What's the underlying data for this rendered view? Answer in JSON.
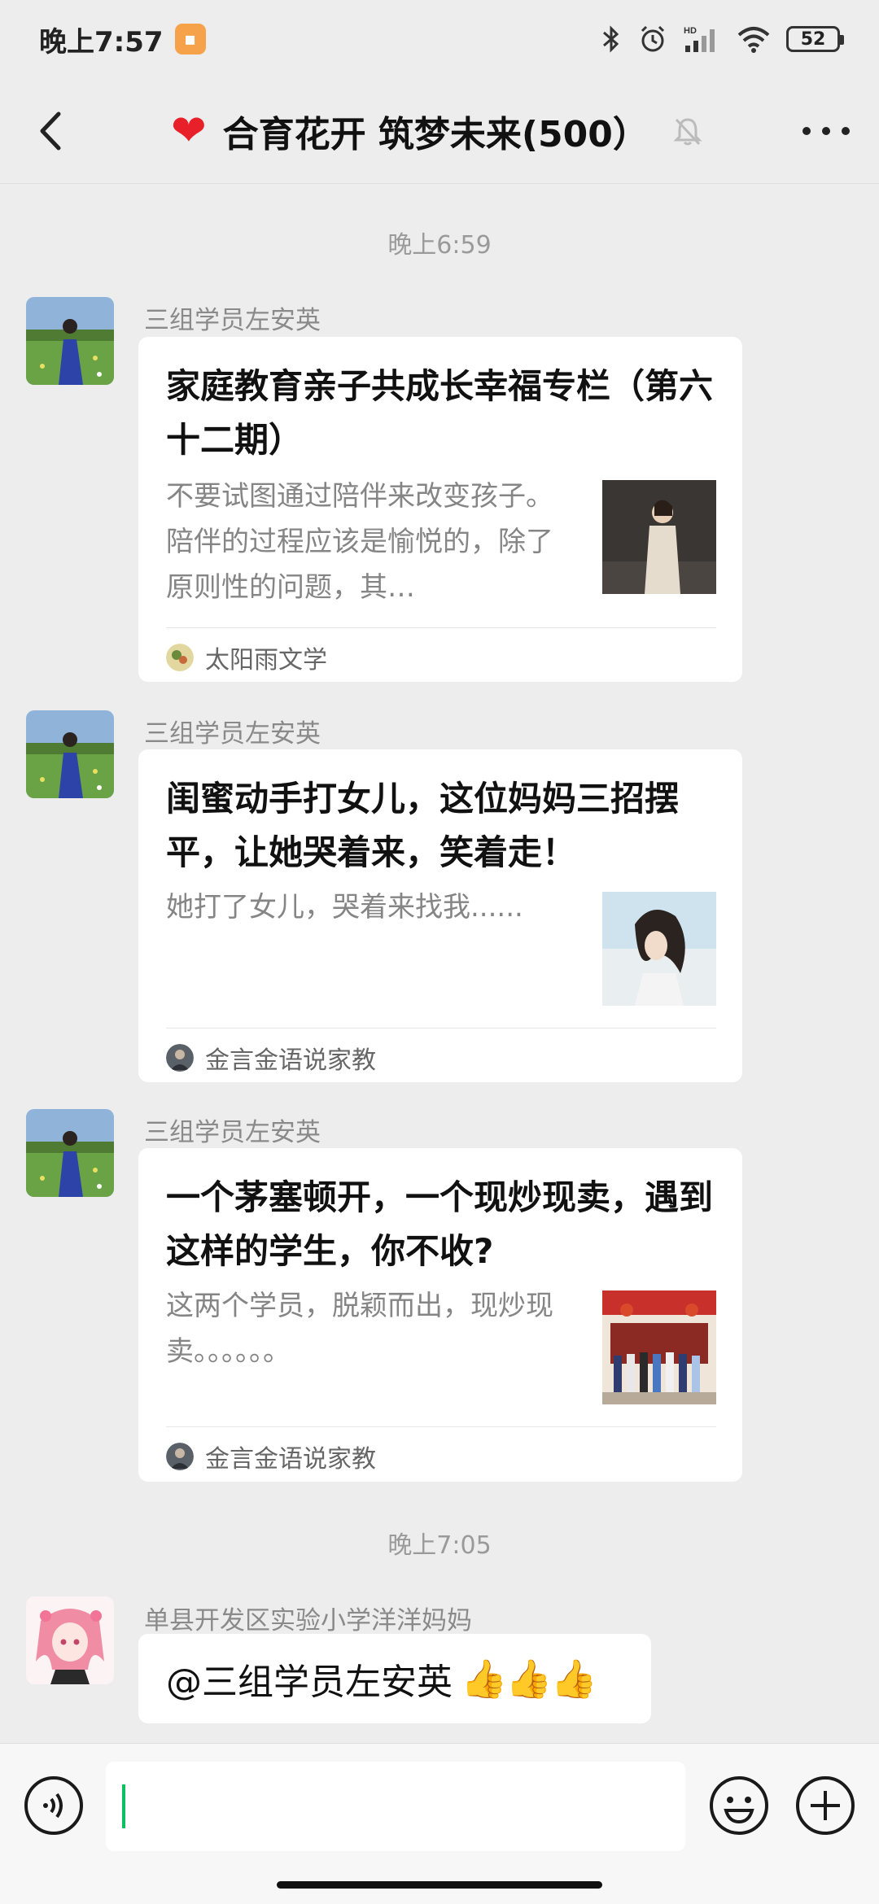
{
  "status": {
    "time": "晚上7:57",
    "battery": "52",
    "signal_label": "HD"
  },
  "nav": {
    "title": "合育花开 筑梦未来(500）"
  },
  "messages": [
    {
      "time": "晚上6:59",
      "sender": "三组学员左安英",
      "card_title": "家庭教育亲子共成长幸福专栏（第六十二期）",
      "card_desc": "不要试图通过陪伴来改变孩子。陪伴的过程应该是愉悦的，除了原则性的问题，其…",
      "source": "太阳雨文学"
    },
    {
      "sender": "三组学员左安英",
      "card_title": "闺蜜动手打女儿，这位妈妈三招摆平，让她哭着来，笑着走！",
      "card_desc": "她打了女儿，哭着来找我......",
      "source": "金言金语说家教"
    },
    {
      "sender": "三组学员左安英",
      "card_title": "一个茅塞顿开，一个现炒现卖，遇到这样的学生，你不收?",
      "card_desc": "这两个学员，脱颖而出，现炒现卖。。。。。。",
      "source": "金言金语说家教"
    },
    {
      "time": "晚上7:05",
      "sender": "单县开发区实验小学洋洋妈妈",
      "text": "@三组学员左安英",
      "emoji": "👍👍👍"
    }
  ]
}
